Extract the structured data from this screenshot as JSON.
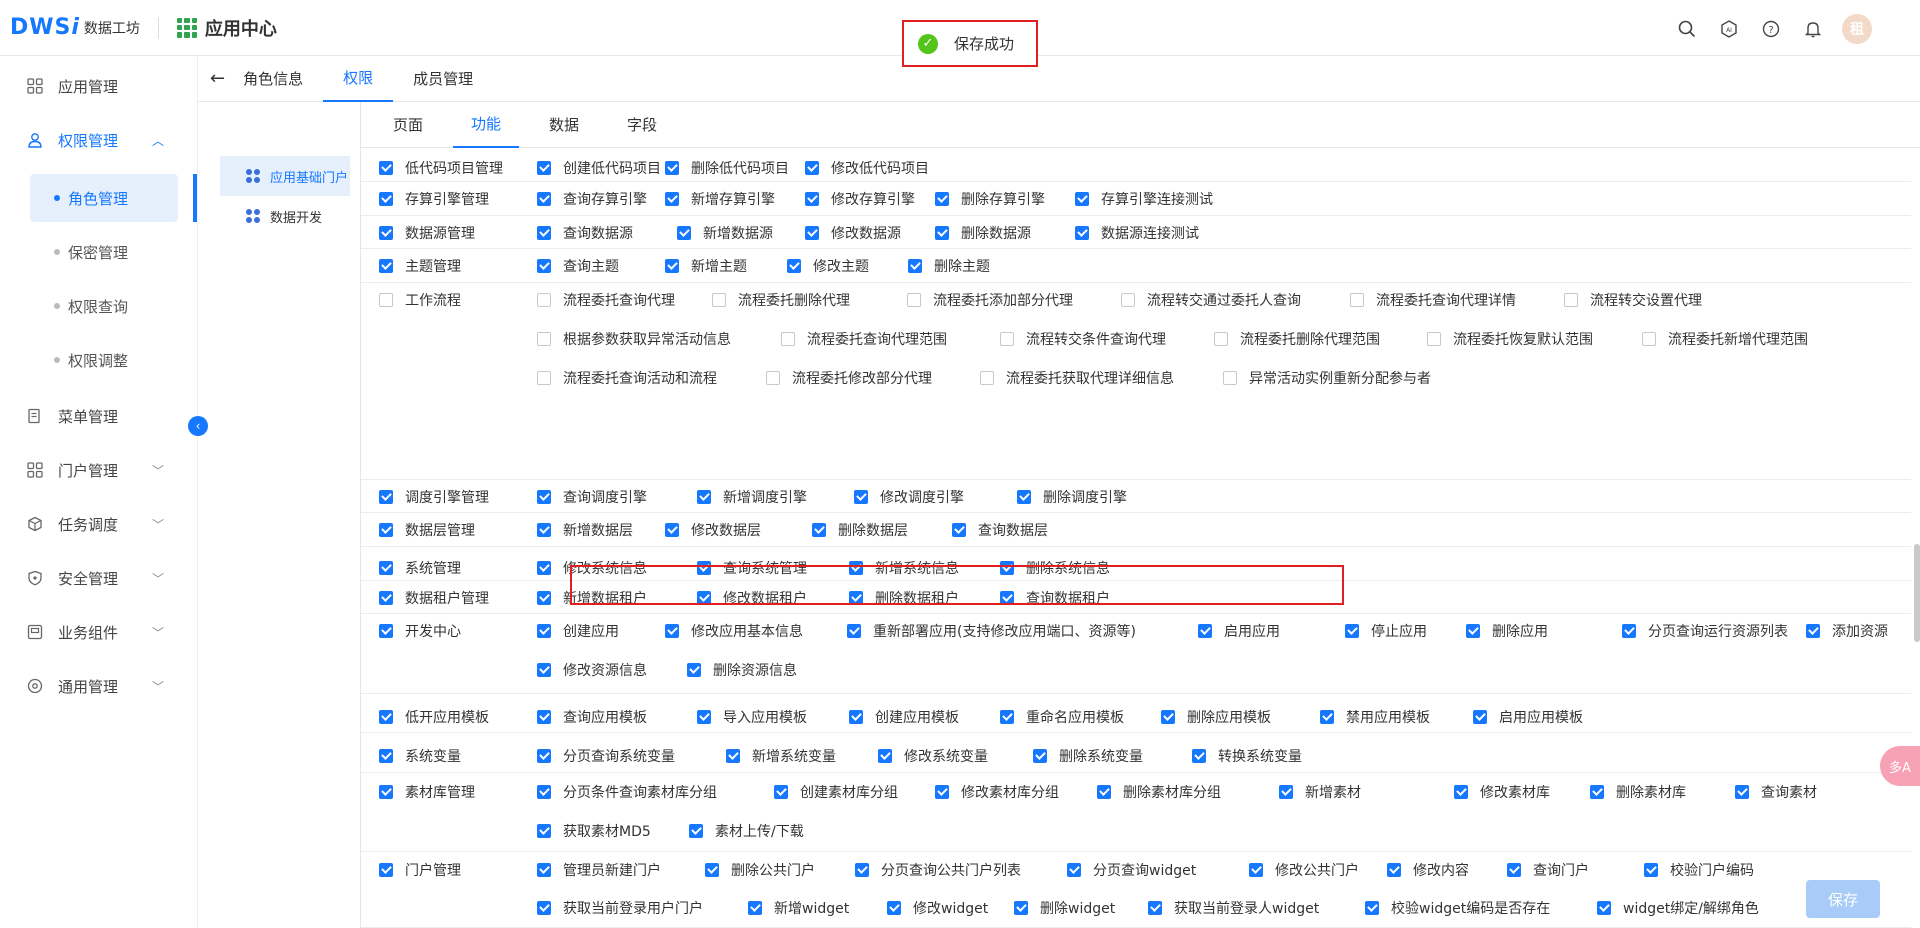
{
  "app": {
    "logo": "DWS",
    "logo_i": "i",
    "logo_text": "数据工坊",
    "center_title": "应用中心",
    "avatar_char": "租"
  },
  "toast": {
    "text": "保存成功"
  },
  "sidebar": {
    "items": [
      {
        "label": "应用管理",
        "icon": "grid-icon"
      },
      {
        "label": "权限管理",
        "icon": "user-icon"
      },
      {
        "label": "菜单管理",
        "icon": "document-icon"
      },
      {
        "label": "门户管理",
        "icon": "grid-icon"
      },
      {
        "label": "任务调度",
        "icon": "cube-icon"
      },
      {
        "label": "安全管理",
        "icon": "shield-icon"
      },
      {
        "label": "业务组件",
        "icon": "component-icon"
      },
      {
        "label": "通用管理",
        "icon": "settings-icon"
      }
    ],
    "subitems": [
      "角色管理",
      "保密管理",
      "权限查询",
      "权限调整"
    ]
  },
  "tabs": [
    "角色信息",
    "权限",
    "成员管理"
  ],
  "tree": [
    "应用基础门户",
    "数据开发"
  ],
  "subtabs": [
    "页面",
    "功能",
    "数据",
    "字段"
  ],
  "rows": [
    {
      "cat": "低代码项目管理",
      "checked": true,
      "items": [
        "创建低代码项目",
        "删除低代码项目",
        "修改低代码项目"
      ]
    },
    {
      "cat": "存算引擎管理",
      "checked": true,
      "items": [
        "查询存算引擎",
        "新增存算引擎",
        "修改存算引擎",
        "删除存算引擎",
        "存算引擎连接测试"
      ]
    },
    {
      "cat": "数据源管理",
      "checked": true,
      "items": [
        "查询数据源",
        "新增数据源",
        "修改数据源",
        "删除数据源",
        "数据源连接测试"
      ]
    },
    {
      "cat": "主题管理",
      "checked": true,
      "items": [
        "查询主题",
        "新增主题",
        "修改主题",
        "删除主题"
      ]
    },
    {
      "cat": "工作流程",
      "checked": false,
      "items": [
        "流程委托查询代理",
        "流程委托删除代理",
        "流程委托添加部分代理",
        "流程转交通过委托人查询",
        "流程委托查询代理详情",
        "流程转交设置代理",
        "根据参数获取异常活动信息",
        "流程委托查询代理范围",
        "流程转交条件查询代理",
        "流程委托删除代理范围",
        "流程委托恢复默认范围",
        "流程委托新增代理范围",
        "流程委托查询活动和流程",
        "流程委托修改部分代理",
        "流程委托获取代理详细信息",
        "异常活动实例重新分配参与者"
      ]
    },
    {
      "cat": "调度引擎管理",
      "checked": true,
      "items": [
        "查询调度引擎",
        "新增调度引擎",
        "修改调度引擎",
        "删除调度引擎"
      ]
    },
    {
      "cat": "数据层管理",
      "checked": true,
      "items": [
        "新增数据层",
        "修改数据层",
        "删除数据层",
        "查询数据层"
      ]
    },
    {
      "cat": "系统管理",
      "checked": true,
      "items": [
        "修改系统信息",
        "查询系统管理",
        "新增系统信息",
        "删除系统信息"
      ]
    },
    {
      "cat": "数据租户管理",
      "checked": true,
      "items": [
        "新增数据租户",
        "修改数据租户",
        "删除数据租户",
        "查询数据租户"
      ]
    },
    {
      "cat": "开发中心",
      "checked": true,
      "items": [
        "创建应用",
        "修改应用基本信息",
        "重新部署应用(支持修改应用端口、资源等)",
        "启用应用",
        "停止应用",
        "删除应用",
        "分页查询运行资源列表",
        "添加资源",
        "修改资源信息",
        "删除资源信息"
      ]
    },
    {
      "cat": "低开应用模板",
      "checked": true,
      "items": [
        "查询应用模板",
        "导入应用模板",
        "创建应用模板",
        "重命名应用模板",
        "删除应用模板",
        "禁用应用模板",
        "启用应用模板"
      ]
    },
    {
      "cat": "系统变量",
      "checked": true,
      "items": [
        "分页查询系统变量",
        "新增系统变量",
        "修改系统变量",
        "删除系统变量",
        "转换系统变量"
      ]
    },
    {
      "cat": "素材库管理",
      "checked": true,
      "items": [
        "分页条件查询素材库分组",
        "创建素材库分组",
        "修改素材库分组",
        "删除素材库分组",
        "新增素材",
        "修改素材库",
        "删除素材库",
        "查询素材",
        "获取素材MD5",
        "素材上传/下载"
      ]
    },
    {
      "cat": "门户管理",
      "checked": true,
      "items": [
        "管理员新建门户",
        "删除公共门户",
        "分页查询公共门户列表",
        "分页查询widget",
        "修改公共门户",
        "修改内容",
        "查询门户",
        "校验门户编码",
        "获取当前登录用户门户",
        "新增widget",
        "修改widget",
        "删除widget",
        "获取当前登录人widget",
        "校验widget编码是否存在",
        "widget绑定/解绑角色"
      ]
    }
  ],
  "save_label": "保存",
  "float_label": "多A"
}
